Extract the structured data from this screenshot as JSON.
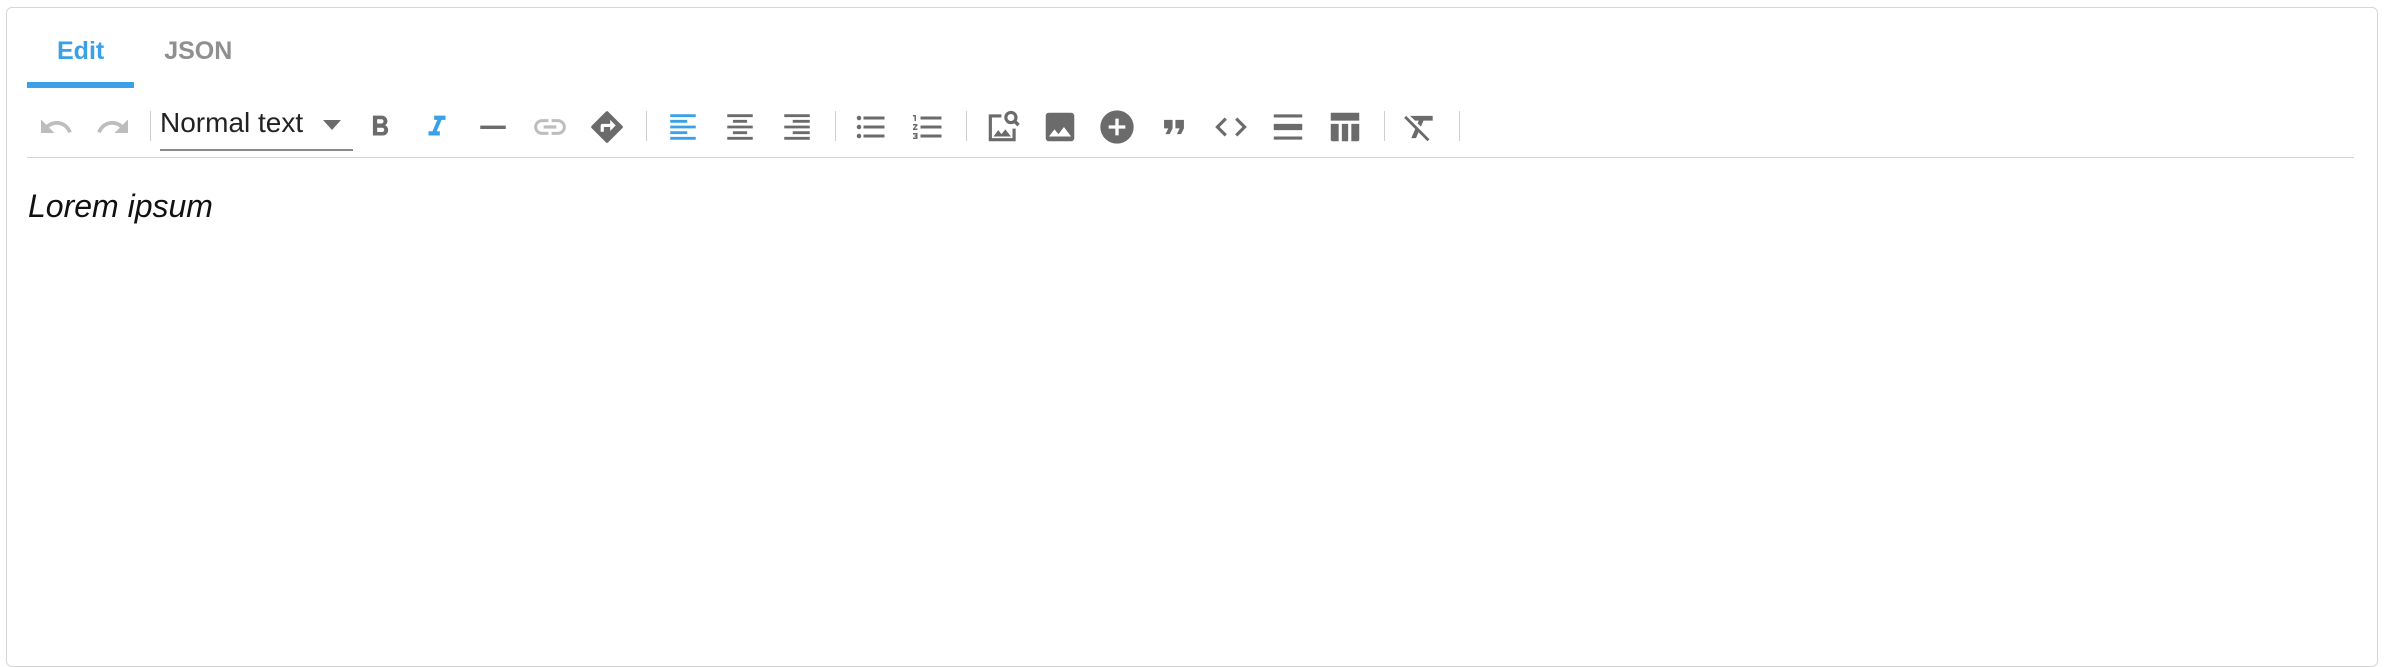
{
  "tabs": [
    {
      "label": "Edit",
      "active": true
    },
    {
      "label": "JSON",
      "active": false
    }
  ],
  "toolbar": {
    "block_type": "Normal text",
    "icons": [
      "undo-icon",
      "redo-icon",
      "bold-icon",
      "italic-icon",
      "strikethrough-icon",
      "link-icon",
      "redirect-icon",
      "align-left-icon",
      "align-center-icon",
      "align-right-icon",
      "bulleted-list-icon",
      "numbered-list-icon",
      "asset-search-icon",
      "image-icon",
      "add-icon",
      "blockquote-icon",
      "code-icon",
      "horizontal-rule-icon",
      "table-icon",
      "clear-formatting-icon"
    ],
    "active_color": "#3aa0e8",
    "icon_color": "#6b6b6b",
    "disabled_color": "#bdbdbd"
  },
  "editor": {
    "content": "Lorem ipsum"
  }
}
